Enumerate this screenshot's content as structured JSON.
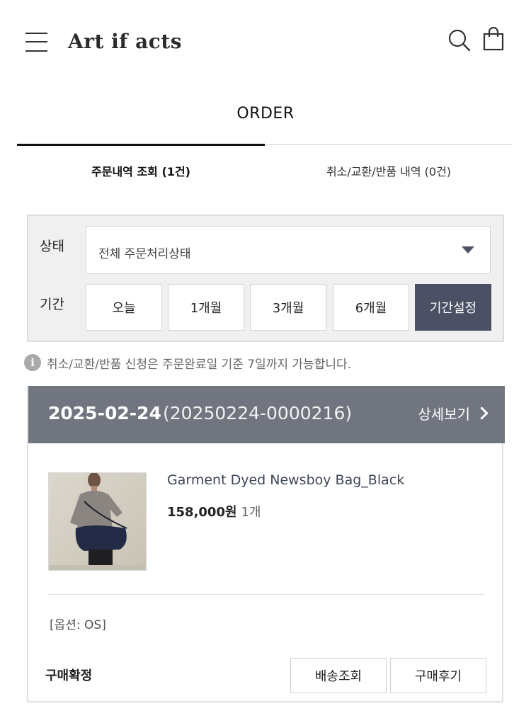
{
  "header": {
    "logo": "Art if acts",
    "menu_icon": "hamburger-menu-icon",
    "search_icon": "search-icon",
    "cart_icon": "shopping-bag-icon"
  },
  "page": {
    "title": "ORDER"
  },
  "tabs": [
    {
      "label": "주문내역 조회 (1건)",
      "active": true
    },
    {
      "label": "취소/교환/반품 내역 (0건)",
      "active": false
    }
  ],
  "filter": {
    "status_label": "상태",
    "status_value": "전체 주문처리상태",
    "period_label": "기간",
    "periods": [
      {
        "label": "오늘",
        "active": false
      },
      {
        "label": "1개월",
        "active": false
      },
      {
        "label": "3개월",
        "active": false
      },
      {
        "label": "6개월",
        "active": false
      },
      {
        "label": "기간설정",
        "active": true
      }
    ]
  },
  "notice": {
    "icon": "info-icon",
    "text": "취소/교환/반품 신청은 주문완료일 기준 7일까지 가능합니다."
  },
  "order": {
    "date": "2025-02-24",
    "number": "(20250224-0000216)",
    "detail_label": "상세보기",
    "product": {
      "name": "Garment Dyed Newsboy Bag_Black",
      "price": "158,000원",
      "qty": "1개",
      "option": "[옵션: OS]"
    },
    "status": "구매확정",
    "buttons": {
      "tracking": "배송조회",
      "review": "구매후기"
    }
  },
  "colors": {
    "accent": "#4b5064",
    "order_header": "#71757f",
    "product_name": "#3e4559"
  }
}
